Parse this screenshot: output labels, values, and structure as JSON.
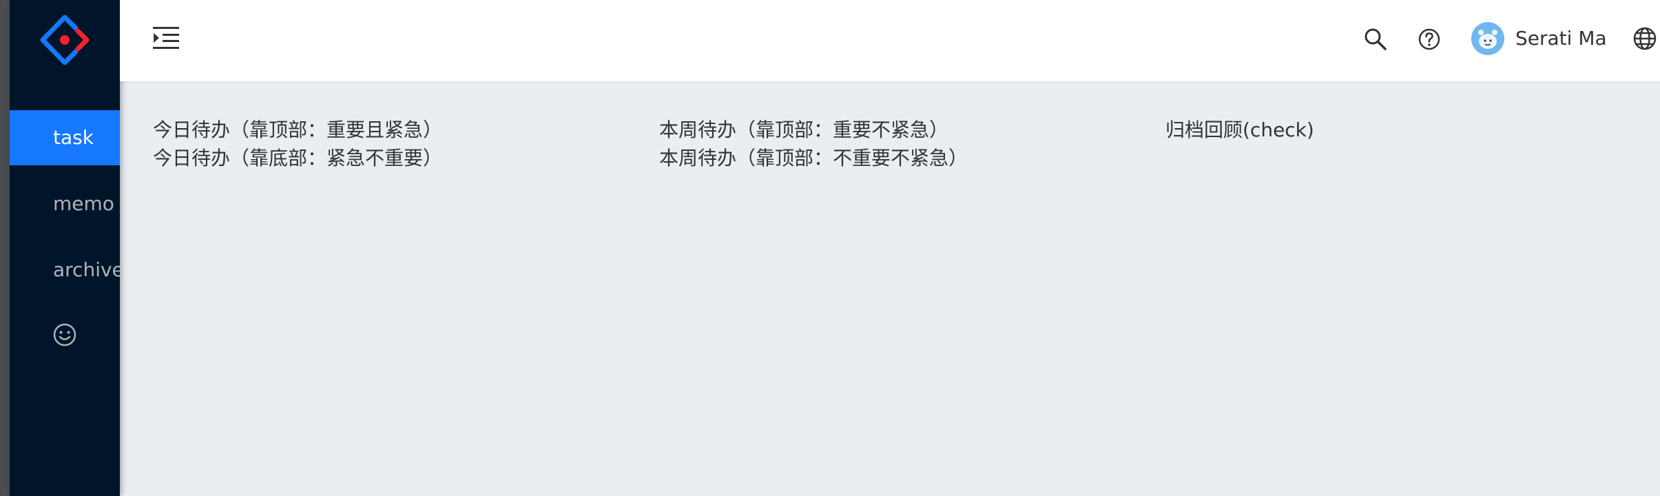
{
  "sidebar": {
    "logo_icon": "ant-design-logo-icon",
    "items": [
      {
        "label": "task",
        "active": true
      },
      {
        "label": "memo",
        "active": false
      },
      {
        "label": "archived",
        "active": false
      }
    ],
    "extra_icon": "smile-icon",
    "colors": {
      "background": "#001529",
      "active": "#1677ff"
    }
  },
  "header": {
    "collapse_icon": "menu-unfold-icon",
    "search_icon": "search-icon",
    "help_icon": "question-circle-icon",
    "user": {
      "name": "Serati Ma",
      "avatar_icon": "avatar-icon"
    },
    "language_icon": "globe-icon"
  },
  "main": {
    "columns": [
      {
        "items": [
          "今日待办（靠顶部：重要且紧急）",
          "今日待办（靠底部：紧急不重要）"
        ]
      },
      {
        "items": [
          "本周待办（靠顶部：重要不紧急）",
          "本周待办（靠顶部：不重要不紧急）"
        ]
      },
      {
        "items": [
          "归档回顾(check)"
        ]
      }
    ]
  }
}
